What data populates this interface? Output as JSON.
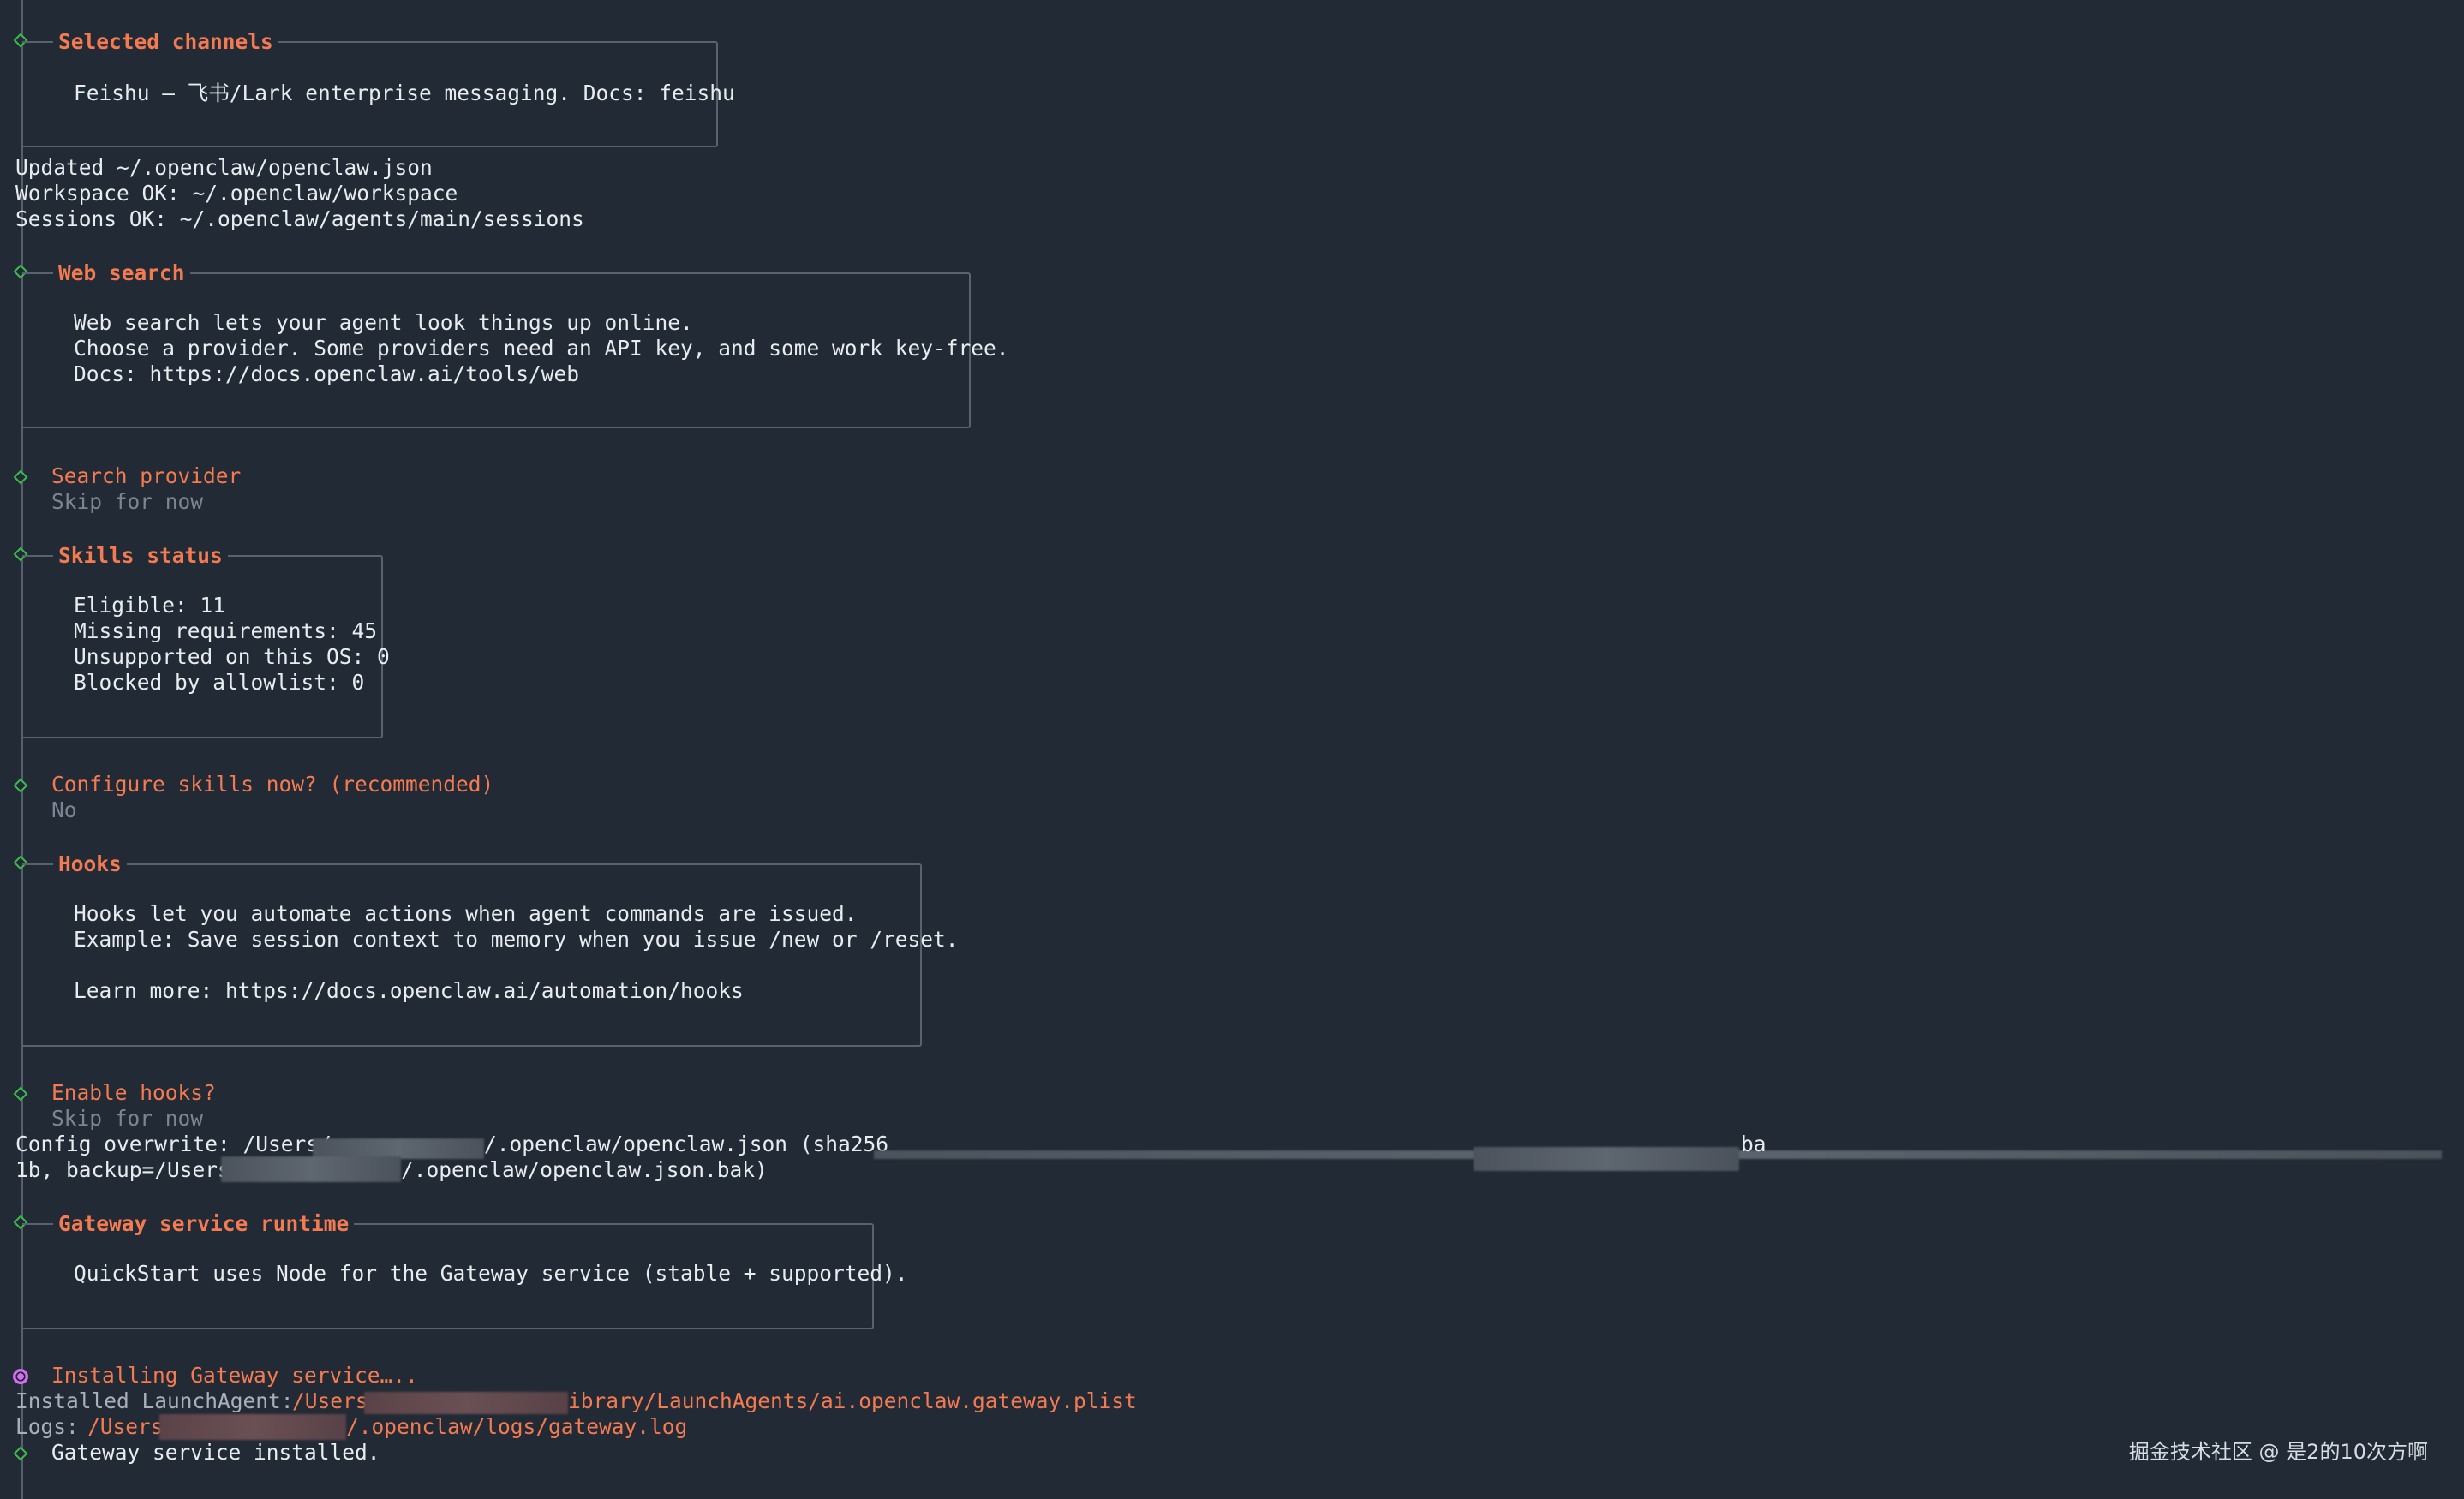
{
  "theme": {
    "background": "#222a35",
    "text": "#e9ecef",
    "accent": "#f47b51",
    "success": "#3fb950",
    "spinner": "#d46df2",
    "muted": "#7c8592"
  },
  "terminal": {
    "selected_channels": {
      "title": "Selected channels",
      "lines": [
        "Feishu — 飞书/Lark enterprise messaging. Docs: feishu"
      ]
    },
    "status_lines": [
      "Updated ~/.openclaw/openclaw.json",
      "Workspace OK: ~/.openclaw/workspace",
      "Sessions OK: ~/.openclaw/agents/main/sessions"
    ],
    "web_search": {
      "title": "Web search",
      "lines": [
        "Web search lets your agent look things up online.",
        "Choose a provider. Some providers need an API key, and some work key-free.",
        "Docs: https://docs.openclaw.ai/tools/web"
      ]
    },
    "search_provider": {
      "question": "Search provider",
      "answer": "Skip for now"
    },
    "skills_status": {
      "title": "Skills status",
      "lines": [
        "Eligible: 11",
        "Missing requirements: 45",
        "Unsupported on this OS: 0",
        "Blocked by allowlist: 0"
      ]
    },
    "configure_skills": {
      "question": "Configure skills now? (recommended)",
      "answer": "No"
    },
    "hooks": {
      "title": "Hooks",
      "lines": [
        "Hooks let you automate actions when agent commands are issued.",
        "Example: Save session context to memory when you issue /new or /reset.",
        "",
        "Learn more: https://docs.openclaw.ai/automation/hooks"
      ]
    },
    "enable_hooks": {
      "question": "Enable hooks?",
      "answer": "Skip for now"
    },
    "config_overwrite": {
      "line1_prefix": "Config overwrite: /Users/",
      "line1_path": "/.openclaw/openclaw.json (sha256",
      "line1_tail": "ba",
      "line2_prefix": "1b, backup=/Users",
      "line2_path": "/.openclaw/openclaw.json.bak)"
    },
    "gateway_runtime": {
      "title": "Gateway service runtime",
      "lines": [
        "QuickStart uses Node for the Gateway service (stable + supported)."
      ]
    },
    "installing": {
      "label": "Installing Gateway service….."
    },
    "launch_agent": {
      "label": "Installed LaunchAgent: ",
      "path_prefix": "/Users",
      "path_suffix": "ibrary/LaunchAgents/ai.openclaw.gateway.plist"
    },
    "logs": {
      "label": "Logs: ",
      "path_prefix": "/Users",
      "path_suffix": "/.openclaw/logs/gateway.log"
    },
    "installed": {
      "label": "Gateway service installed."
    }
  },
  "watermark": "掘金技术社区 @ 是2的10次方啊"
}
